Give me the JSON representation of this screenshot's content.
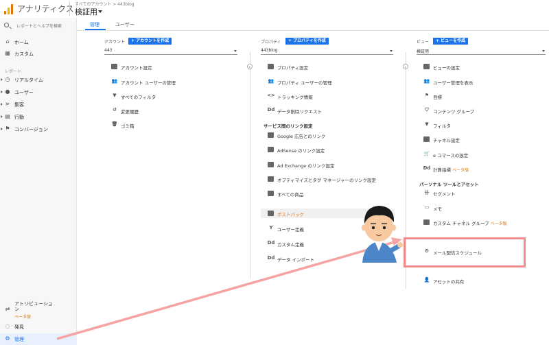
{
  "app": {
    "title": "アナリティクス",
    "account_path": "すべてのアカウント > 443blog",
    "view_name": "検証用"
  },
  "sidebar": {
    "search_placeholder": "レポートとヘルプを検索",
    "items_top": [
      {
        "label": "ホーム",
        "icon": "home-icon"
      },
      {
        "label": "カスタム",
        "icon": "grid-icon"
      }
    ],
    "section_label": "レポート",
    "report_items": [
      {
        "label": "リアルタイム",
        "icon": "clock-icon"
      },
      {
        "label": "ユーザー",
        "icon": "person-icon"
      },
      {
        "label": "集客",
        "icon": "share-icon"
      },
      {
        "label": "行動",
        "icon": "window-icon"
      },
      {
        "label": "コンバージョン",
        "icon": "flag-icon"
      }
    ],
    "attribution_label": "アトリビューション",
    "attribution_badge": "ベータ版",
    "discover_label": "発見",
    "admin_label": "管理"
  },
  "tabs": [
    {
      "label": "管理",
      "active": true
    },
    {
      "label": "ユーザー",
      "active": false
    }
  ],
  "account_col": {
    "heading": "アカウント",
    "create_label": "+ アカウントを作成",
    "selected": "443",
    "items": [
      {
        "label": "アカウント設定",
        "icon": "building-icon"
      },
      {
        "label": "アカウント ユーザーの管理",
        "icon": "users-icon"
      },
      {
        "label": "すべてのフィルタ",
        "icon": "filter-icon"
      },
      {
        "label": "変更履歴",
        "icon": "history-icon"
      },
      {
        "label": "ゴミ箱",
        "icon": "trash-icon"
      }
    ]
  },
  "property_col": {
    "heading": "プロパティ",
    "create_label": "+ プロパティを作成",
    "selected": "443blog",
    "items": [
      {
        "label": "プロパティ設定",
        "icon": "property-icon"
      },
      {
        "label": "プロパティ ユーザーの管理",
        "icon": "users-icon"
      },
      {
        "label": "トラッキング情報",
        "icon": "code-icon"
      },
      {
        "label": "データ削除リクエスト",
        "icon": "dd-icon"
      }
    ],
    "links_heading": "サービス間のリンク設定",
    "link_items": [
      {
        "label": "Google 広告とのリンク",
        "icon": "ads-icon"
      },
      {
        "label": "AdSense のリンク設定",
        "icon": "adsense-icon"
      },
      {
        "label": "Ad Exchange のリンク設定",
        "icon": "adx-icon"
      },
      {
        "label": "オプティマイズとタグ マネージャーのリンク設定",
        "icon": "optimize-icon"
      },
      {
        "label": "すべての商品",
        "icon": "products-icon"
      }
    ],
    "other_items": [
      {
        "label": "ポストバック",
        "icon": "postback-icon"
      },
      {
        "label": "ユーザー定義",
        "icon": "fork-icon"
      },
      {
        "label": "カスタム定義",
        "icon": "dd-icon"
      },
      {
        "label": "データ インポート",
        "icon": "dd-icon"
      }
    ]
  },
  "view_col": {
    "heading": "ビュー",
    "create_label": "+ ビューを作成",
    "selected": "検証用",
    "items": [
      {
        "label": "ビューの設定",
        "icon": "doc-icon"
      },
      {
        "label": "ユーザー管理を表示",
        "icon": "users-icon"
      },
      {
        "label": "目標",
        "icon": "flag-icon"
      },
      {
        "label": "コンテンツ グループ",
        "icon": "person-group-icon"
      },
      {
        "label": "フィルタ",
        "icon": "filter-icon"
      },
      {
        "label": "チャネル設定",
        "icon": "channel-icon"
      },
      {
        "label": "e コマースの設定",
        "icon": "cart-icon"
      },
      {
        "label": "計算指標",
        "icon": "dd-icon",
        "badge": "ベータ版"
      }
    ],
    "personal_heading": "パーソナル ツールとアセット",
    "personal_items": [
      {
        "label": "セグメント",
        "icon": "segment-icon"
      },
      {
        "label": "メモ",
        "icon": "memo-icon"
      },
      {
        "label": "カスタム チャネル グループ",
        "icon": "channel-icon",
        "badge": "ベータ版"
      },
      {
        "label": "メール配信スケジュール",
        "icon": "schedule-icon"
      },
      {
        "label": "アセットの共有",
        "icon": "share-user-icon"
      }
    ]
  },
  "colors": {
    "accent": "#1a73e8",
    "highlight": "#f28c8c",
    "beta": "#e37400"
  }
}
